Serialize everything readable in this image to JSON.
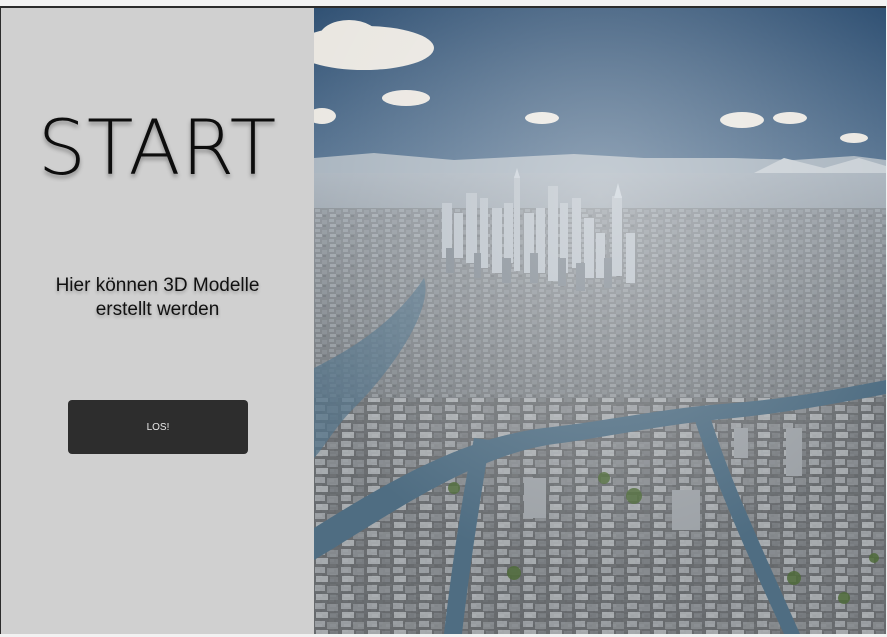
{
  "start_panel": {
    "title": "START",
    "subtitle_line1": "Hier können 3D Modelle",
    "subtitle_line2": "erstellt werden",
    "button_label": "LOS!"
  },
  "hero_image": {
    "subject": "aerial-city-skyline-river"
  },
  "colors": {
    "panel_background": "#d0d0d0",
    "button_background": "#2d2d2d",
    "button_text": "#e8e8e8",
    "title_text": "#0d0d0d"
  }
}
